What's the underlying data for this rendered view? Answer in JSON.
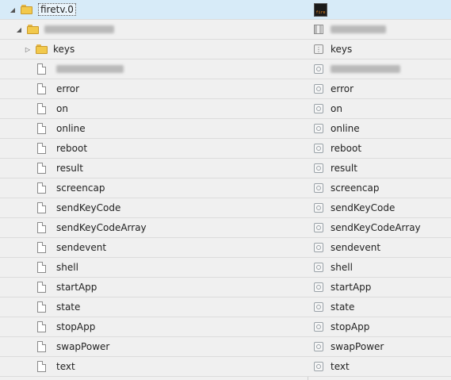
{
  "root": {
    "label": "firetv.0"
  },
  "device": {
    "label": "",
    "value": ""
  },
  "channel": {
    "label": "keys",
    "value": "keys"
  },
  "hidden_state": {
    "label": "",
    "value": ""
  },
  "states": [
    {
      "label": "error",
      "value": "error"
    },
    {
      "label": "on",
      "value": "on"
    },
    {
      "label": "online",
      "value": "online"
    },
    {
      "label": "reboot",
      "value": "reboot"
    },
    {
      "label": "result",
      "value": "result"
    },
    {
      "label": "screencap",
      "value": "screencap"
    },
    {
      "label": "sendKeyCode",
      "value": "sendKeyCode"
    },
    {
      "label": "sendKeyCodeArray",
      "value": "sendKeyCodeArray"
    },
    {
      "label": "sendevent",
      "value": "sendevent"
    },
    {
      "label": "shell",
      "value": "shell"
    },
    {
      "label": "startApp",
      "value": "startApp"
    },
    {
      "label": "state",
      "value": "state"
    },
    {
      "label": "stopApp",
      "value": "stopApp"
    },
    {
      "label": "swapPower",
      "value": "swapPower"
    },
    {
      "label": "text",
      "value": "text"
    }
  ],
  "icons": {
    "folder": "folder-icon",
    "document": "document-icon",
    "state": "state-icon",
    "channel": "channel-icon",
    "device": "device-icon",
    "adapter_logo": "firetv-logo-icon"
  },
  "colors": {
    "selected_row": "#d7ebf8",
    "folder": "#f2c94c",
    "background": "#f0f0f0"
  }
}
